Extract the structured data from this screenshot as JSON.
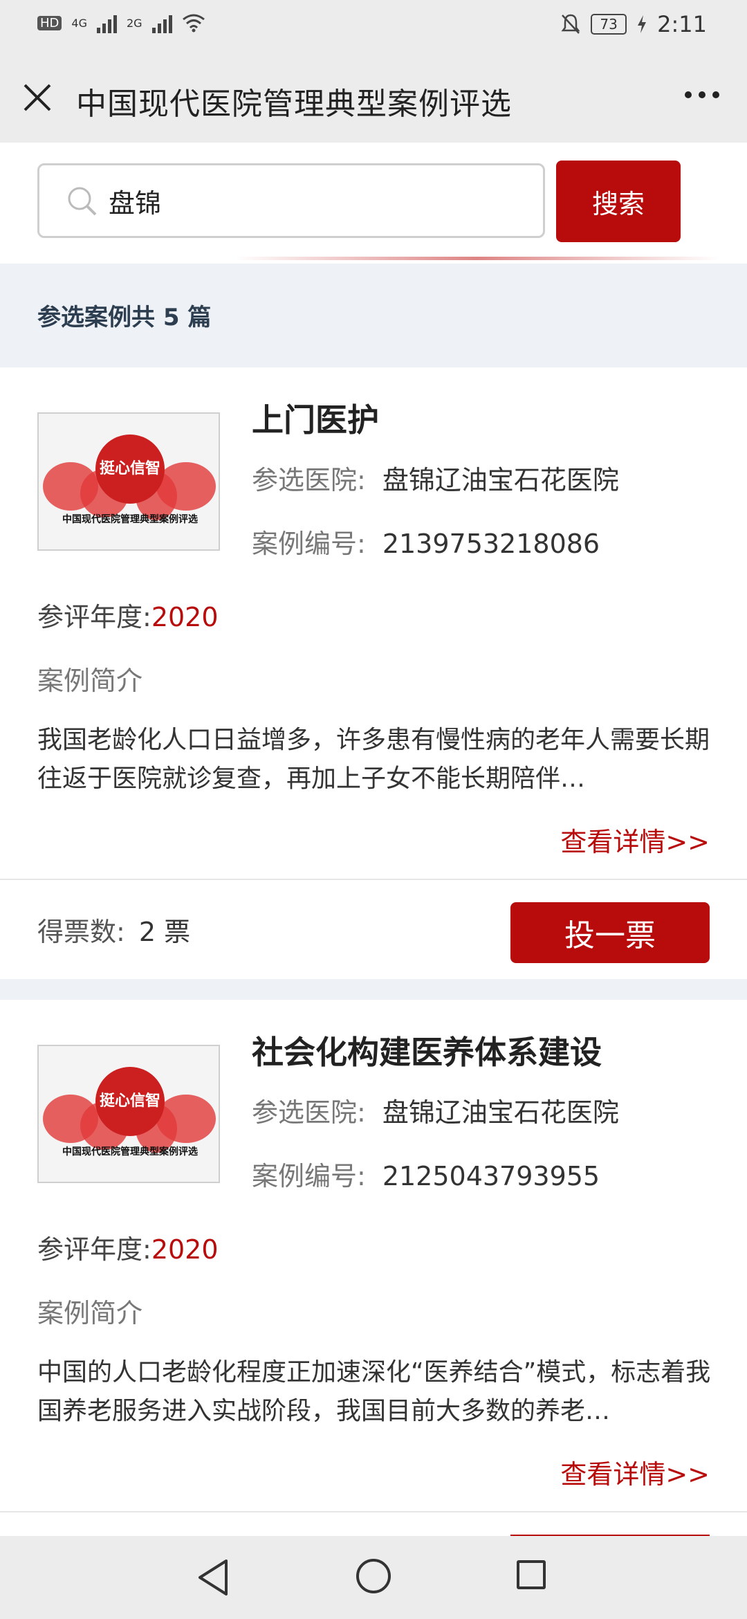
{
  "status_bar": {
    "hd": "HD",
    "net1": "4G",
    "net2": "2G",
    "battery": "73",
    "time": "2:11",
    "icons": [
      "signal-icon",
      "wifi-icon",
      "mute-bell-icon",
      "battery-icon",
      "charging-icon"
    ]
  },
  "header": {
    "title": "中国现代医院管理典型案例评选",
    "close_icon": "close-icon",
    "more_icon": "more-icon"
  },
  "search": {
    "query": "盘锦",
    "button_label": "搜索"
  },
  "results": {
    "count_text": "参选案例共 5 篇"
  },
  "labels": {
    "hospital": "参选医院:",
    "case_no": "案例编号:",
    "year": "参评年度:",
    "intro": "案例简介",
    "detail": "查看详情>>",
    "votes": "得票数:",
    "vote_button": "投一票"
  },
  "cards": [
    {
      "title": "上门医护",
      "hospital": "盘锦辽油宝石花医院",
      "case_no": "2139753218086",
      "year": "2020",
      "intro": "我国老龄化人口日益增多，许多患有慢性病的老年人需要长期往返于医院就诊复查，再加上子女不能长期陪伴…",
      "votes": "2 票",
      "thumb_badge": "挺心信智",
      "thumb_caption": "中国现代医院管理典型案例评选"
    },
    {
      "title": "社会化构建医养体系建设",
      "hospital": "盘锦辽油宝石花医院",
      "case_no": "2125043793955",
      "year": "2020",
      "intro": "中国的人口老龄化程度正加速深化“医养结合”模式，标志着我国养老服务进入实战阶段，我国目前大多数的养老…",
      "thumb_badge": "挺心信智",
      "thumb_caption": "中国现代医院管理典型案例评选"
    }
  ],
  "nav_bar": {
    "icons": [
      "back-triangle-icon",
      "home-circle-icon",
      "recent-square-icon"
    ]
  },
  "colors": {
    "accent": "#b80c0c",
    "header_bg": "#ececec",
    "section_bg": "#eef1f5"
  }
}
